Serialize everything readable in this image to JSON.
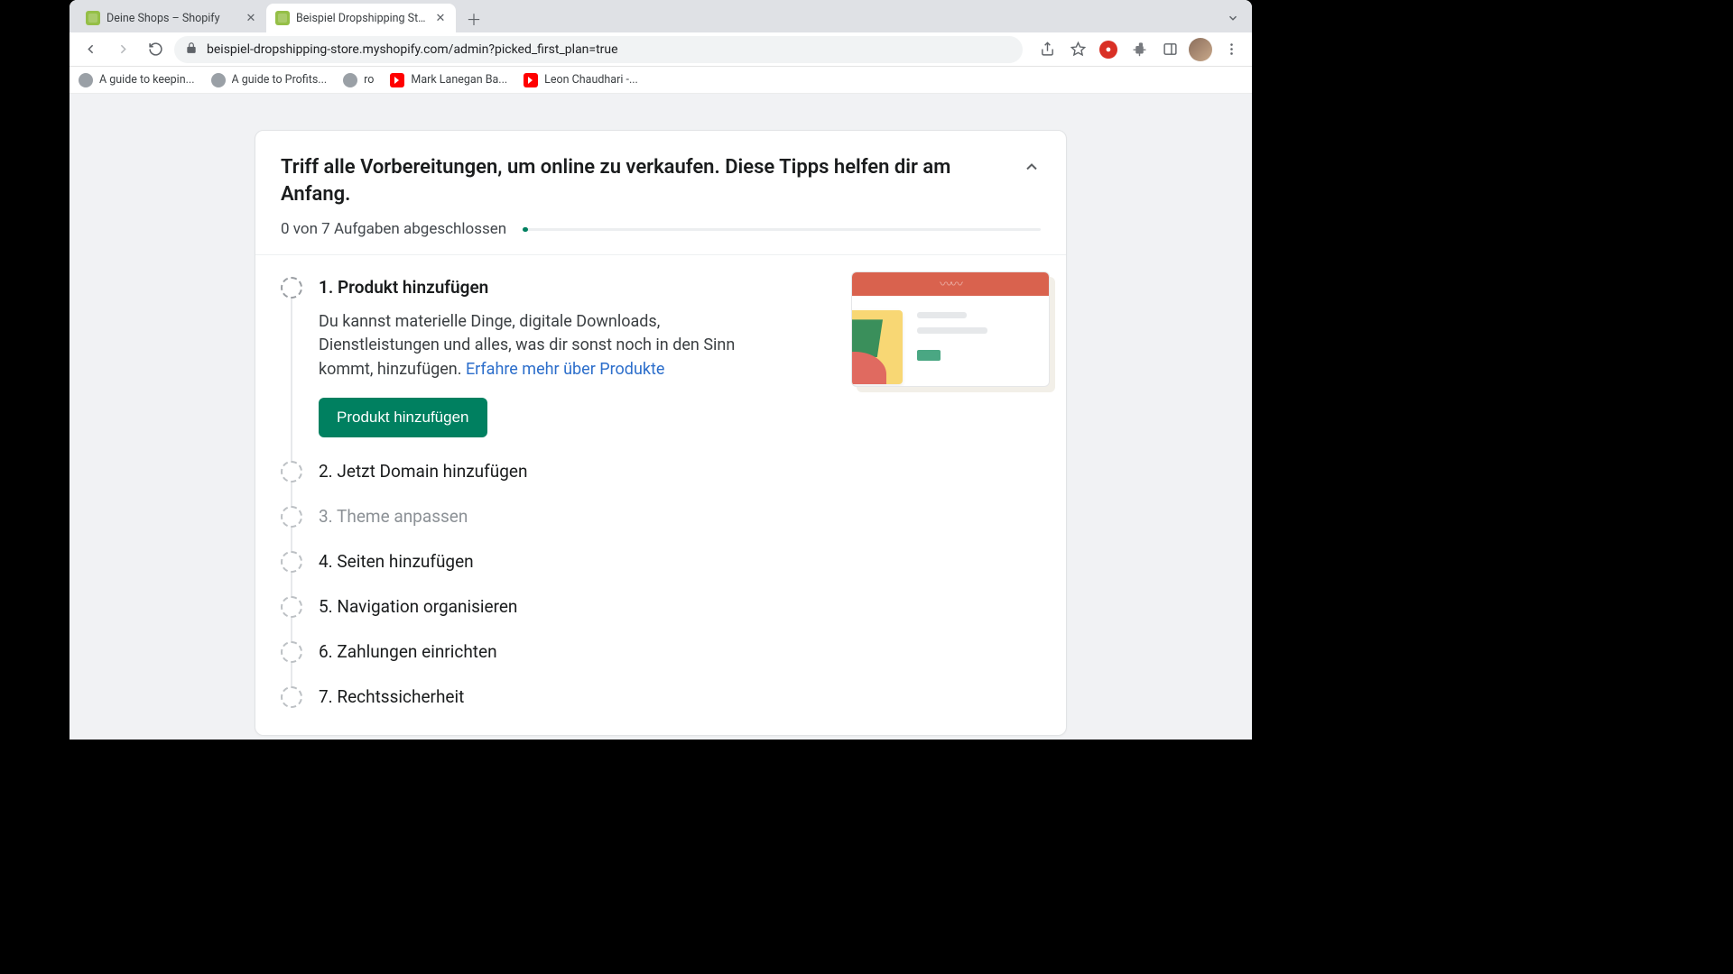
{
  "tabs": [
    {
      "title": "Deine Shops – Shopify",
      "active": false
    },
    {
      "title": "Beispiel Dropshipping Store · H",
      "active": true
    }
  ],
  "url": "beispiel-dropshipping-store.myshopify.com/admin?picked_first_plan=true",
  "bookmarks": [
    {
      "label": "A guide to keepin...",
      "kind": "globe"
    },
    {
      "label": "A guide to Profits...",
      "kind": "globe"
    },
    {
      "label": "ro",
      "kind": "globe"
    },
    {
      "label": "Mark Lanegan Ba...",
      "kind": "yt"
    },
    {
      "label": "Leon Chaudhari -...",
      "kind": "yt"
    }
  ],
  "card": {
    "title": "Triff alle Vorbereitungen, um online zu verkaufen. Diese Tipps helfen dir am Anfang.",
    "progress_text": "0 von 7 Aufgaben abgeschlossen"
  },
  "steps": [
    {
      "label": "1. Produkt hinzufügen",
      "active": true,
      "desc": "Du kannst materielle Dinge, digitale Downloads, Dienstleistungen und alles, was dir sonst noch in den Sinn kommt, hinzufügen. ",
      "link_text": "Erfahre mehr über Produkte",
      "button": "Produkt hinzufügen"
    },
    {
      "label": "2. Jetzt Domain hinzufügen"
    },
    {
      "label": "3. Theme anpassen",
      "dim": true
    },
    {
      "label": "4. Seiten hinzufügen"
    },
    {
      "label": "5. Navigation organisieren"
    },
    {
      "label": "6. Zahlungen einrichten"
    },
    {
      "label": "7. Rechtssicherheit"
    }
  ]
}
